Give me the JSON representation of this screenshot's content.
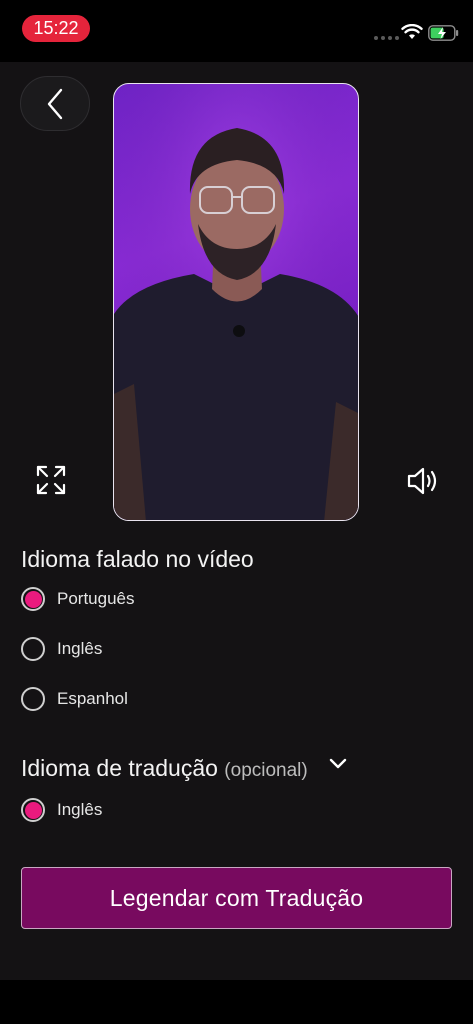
{
  "status": {
    "time": "15:22"
  },
  "spoken_language": {
    "title": "Idioma falado no vídeo",
    "options": [
      {
        "label": "Português",
        "selected": true
      },
      {
        "label": "Inglês",
        "selected": false
      },
      {
        "label": "Espanhol",
        "selected": false
      }
    ]
  },
  "translation_language": {
    "title": "Idioma de tradução",
    "optional_label": "(opcional)",
    "options": [
      {
        "label": "Inglês",
        "selected": true
      }
    ]
  },
  "cta": {
    "label": "Legendar com Tradução"
  },
  "colors": {
    "accent": "#ea1a7e",
    "cta_bg": "#780a5f",
    "time_pill": "#e5243b",
    "background": "#141214"
  }
}
